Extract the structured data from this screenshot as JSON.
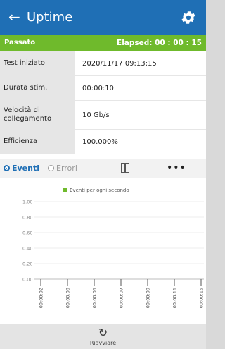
{
  "header": {
    "back_icon": "arrow-left-icon",
    "back_glyph": "←",
    "title": "Uptime",
    "settings_icon": "gear-icon",
    "bg_color": "#1f6fb5"
  },
  "status": {
    "left": "Passato",
    "right": "Elapsed: 00 : 00 : 15",
    "bg_color": "#6fba2c"
  },
  "info_rows": [
    {
      "key": "Test iniziato",
      "value": "2020/11/17 09:13:15"
    },
    {
      "key": "Durata stim.",
      "value": "00:00:10"
    },
    {
      "key": "Velocità di collegamento",
      "value": "10 Gb/s"
    },
    {
      "key": "Efficienza",
      "value": "100.000%"
    }
  ],
  "tabs": {
    "events_label": "Eventi",
    "errors_label": "Errori",
    "selected": "Eventi",
    "split_icon": "split-view-icon",
    "more_icon": "more-horizontal-icon",
    "more_glyph": "•••"
  },
  "chart_data": {
    "type": "bar",
    "title": "",
    "legend": [
      "Eventi per ogni secondo"
    ],
    "legend_placement": "top-center",
    "legend_color": "#6fba2c",
    "categories": [
      "00:00:02",
      "00:00:03",
      "00:00:05",
      "00:00:07",
      "00:00:09",
      "00:00:11",
      "00:00:15"
    ],
    "series": [
      {
        "name": "Eventi per ogni secondo",
        "values": [
          0,
          0,
          0,
          0,
          0,
          0,
          0
        ]
      }
    ],
    "ylim": [
      0,
      1
    ],
    "yticks": [
      "1.00",
      "0.80",
      "0.60",
      "0.40",
      "0.20",
      "0.00"
    ],
    "grid": true
  },
  "footer": {
    "refresh_icon": "refresh-icon",
    "refresh_glyph": "↻",
    "label": "Riavviare"
  }
}
